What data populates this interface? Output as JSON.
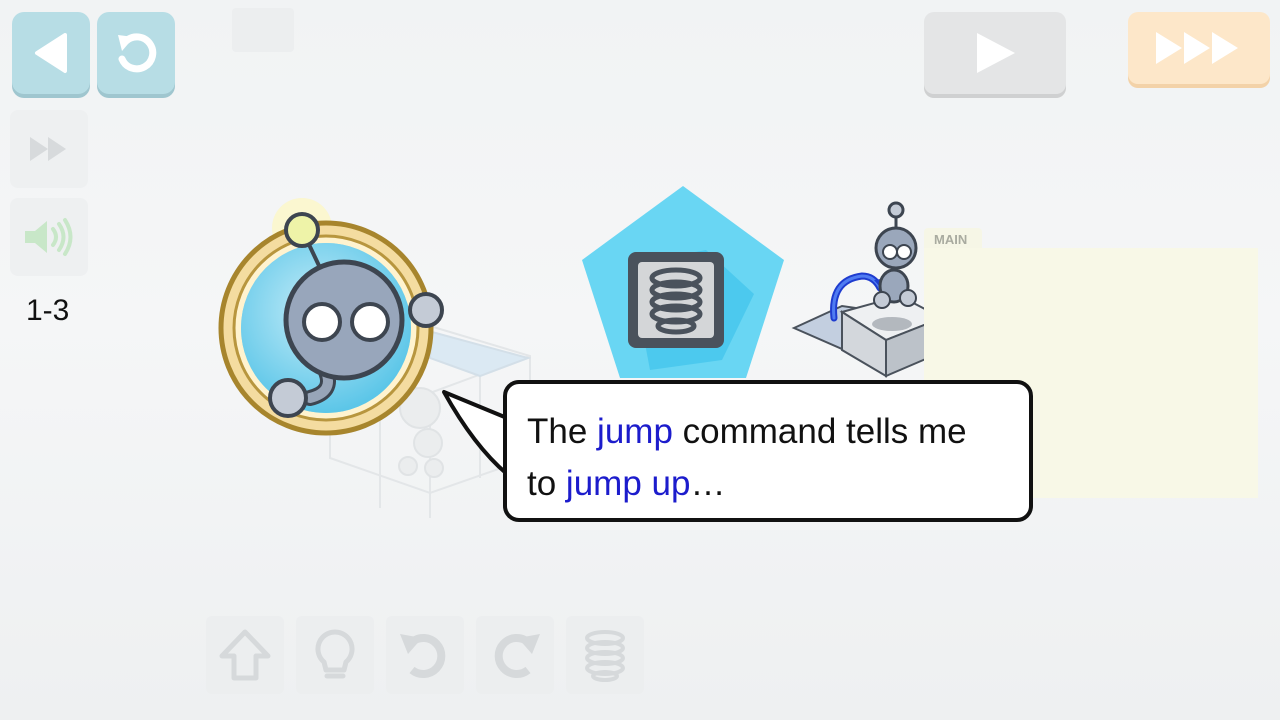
{
  "level": {
    "label": "1-3"
  },
  "program": {
    "main_label": "MAIN"
  },
  "dialog": {
    "parts": [
      {
        "text": "The ",
        "highlight": false
      },
      {
        "text": "jump",
        "highlight": true
      },
      {
        "text": " command tells me",
        "highlight": false
      },
      {
        "text": "to ",
        "highlight": false
      },
      {
        "text": "jump up",
        "highlight": true
      },
      {
        "text": "…",
        "highlight": false
      }
    ]
  },
  "icons": {
    "back": "back-arrow-icon",
    "reset": "reset-icon",
    "speed": "speed-icon",
    "sound": "speaker-icon",
    "play": "play-icon",
    "fast_forward": "fast-forward-icon",
    "commands": [
      "walk-icon",
      "light-icon",
      "turn-left-icon",
      "turn-right-icon",
      "jump-icon"
    ]
  },
  "colors": {
    "accent_blue": "#b7dde5",
    "highlight_text": "#1c1ccc",
    "jump_pentagon": "#66d7f4",
    "main_panel": "#f8f8e7",
    "fast_forward": "#fde7c9"
  }
}
